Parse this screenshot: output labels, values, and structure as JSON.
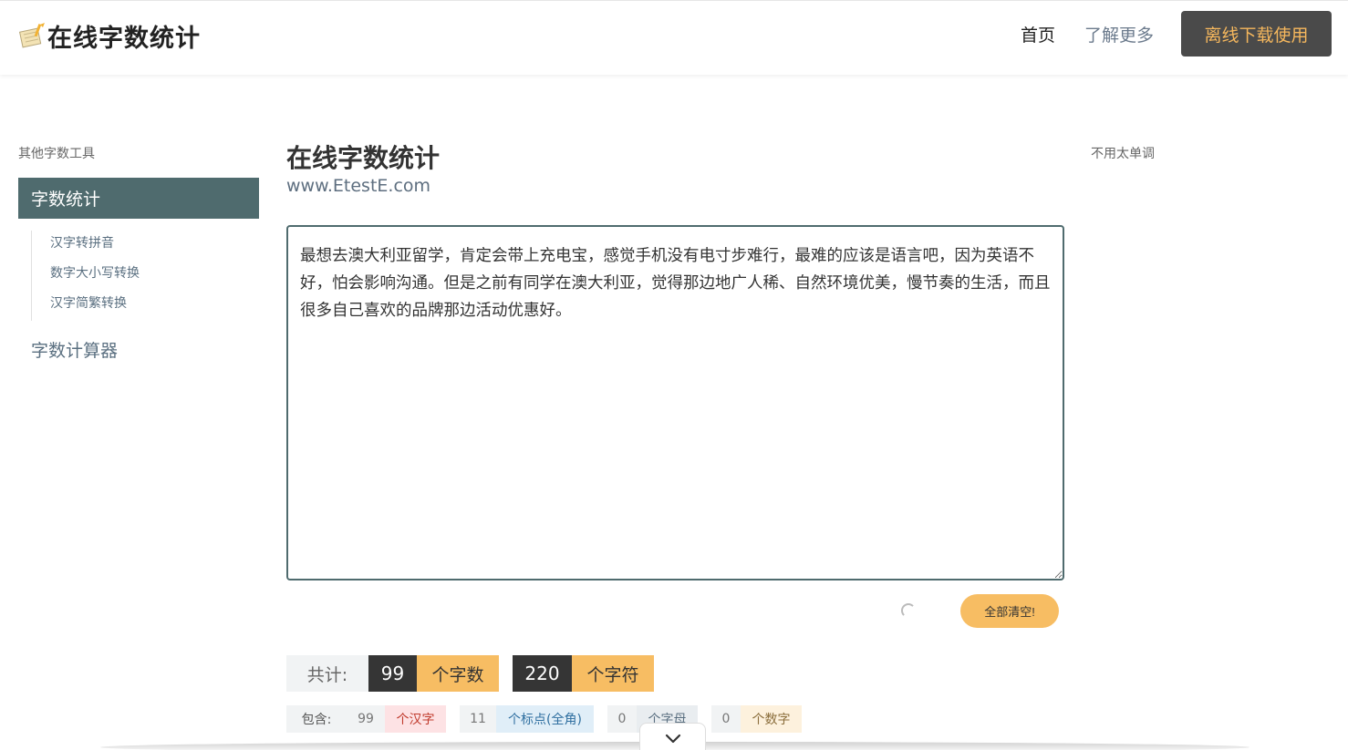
{
  "header": {
    "logo_text": "在线字数统计",
    "nav": {
      "home": "首页",
      "more": "了解更多",
      "download": "离线下载使用"
    }
  },
  "sidebar": {
    "title": "其他字数工具",
    "active_item": "字数统计",
    "sub_items": [
      {
        "label": "汉字转拼音"
      },
      {
        "label": "数字大小写转换"
      },
      {
        "label": "汉字简繁转换"
      }
    ],
    "calc_item": "字数计算器"
  },
  "main": {
    "title": "在线字数统计",
    "subtitle": "www.EtestE.com",
    "right_note": "不用太单调",
    "editor_text": "最想去澳大利亚留学，肯定会带上充电宝，感觉手机没有电寸步难行，最难的应该是语言吧，因为英语不好，怕会影响沟通。但是之前有同学在澳大利亚，觉得那边地广人稀、自然环境优美，慢节奏的生活，而且很多自己喜欢的品牌那边活动优惠好。",
    "clear_button": "全部清空!"
  },
  "stats": {
    "total_label": "共计:",
    "word_count": "99",
    "word_unit": "个字数",
    "char_count": "220",
    "char_unit": "个字符",
    "contains_label": "包含:",
    "hanzi_count": "99",
    "hanzi_unit": "个汉字",
    "punct_count": "11",
    "punct_unit": "个标点(全角)",
    "letter_count": "0",
    "letter_unit": "个字母",
    "digit_count": "0",
    "digit_unit": "个数字"
  },
  "colors": {
    "accent": "#4f6b6e",
    "orange": "#f7bd63",
    "dark": "#353535"
  }
}
